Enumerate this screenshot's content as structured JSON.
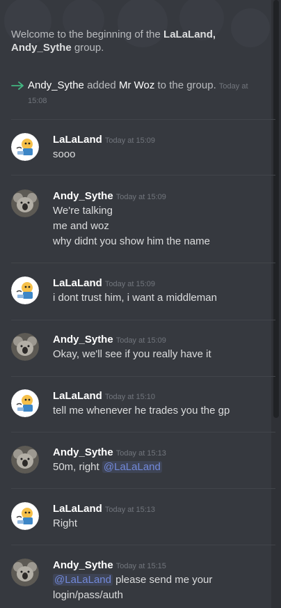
{
  "group": {
    "welcome_prefix": "Welcome to the beginning of the ",
    "welcome_names": "LaLaLand, Andy_Sythe",
    "welcome_suffix": " group."
  },
  "system": {
    "actor": "Andy_Sythe",
    "verb": "added",
    "target": "Mr Woz",
    "rest": "to the group.",
    "time": "Today at 15:08",
    "icon": "join-arrow-icon",
    "icon_color": "#43b581"
  },
  "colors": {
    "background": "#36393f",
    "mention": "#7289da",
    "author": "#ffffff",
    "timestamp": "#72767d"
  },
  "messages": [
    {
      "author": "LaLaLand",
      "avatar": "lalaland-avatar",
      "time": "Today at 15:09",
      "lines": [
        "sooo"
      ]
    },
    {
      "author": "Andy_Sythe",
      "avatar": "koala-avatar",
      "time": "Today at 15:09",
      "lines": [
        "We're talking",
        "me and woz",
        "why didnt you show him the name"
      ]
    },
    {
      "author": "LaLaLand",
      "avatar": "lalaland-avatar",
      "time": "Today at 15:09",
      "lines": [
        "i dont trust him, i want a middleman"
      ]
    },
    {
      "author": "Andy_Sythe",
      "avatar": "koala-avatar",
      "time": "Today at 15:09",
      "lines": [
        "Okay, we'll see if you really have it"
      ]
    },
    {
      "author": "LaLaLand",
      "avatar": "lalaland-avatar",
      "time": "Today at 15:10",
      "lines": [
        "tell me whenever he trades you the gp"
      ]
    },
    {
      "author": "Andy_Sythe",
      "avatar": "koala-avatar",
      "time": "Today at 15:13",
      "text_before": "50m, right ",
      "mention": "@LaLaLand",
      "lines": []
    },
    {
      "author": "LaLaLand",
      "avatar": "lalaland-avatar",
      "time": "Today at 15:13",
      "lines": [
        "Right"
      ]
    },
    {
      "author": "Andy_Sythe",
      "avatar": "koala-avatar",
      "time": "Today at 15:15",
      "mention": "@LaLaLand",
      "text_after": " please send me your",
      "lines": [
        "login/pass/auth"
      ]
    }
  ]
}
